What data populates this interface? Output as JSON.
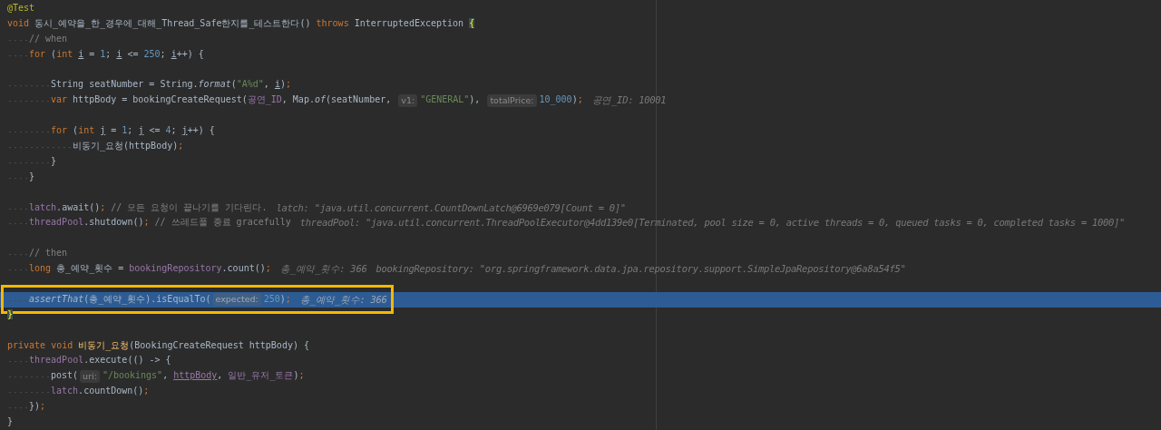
{
  "editor": {
    "lines": [
      {
        "kind": "code",
        "segments": [
          {
            "kind": "code",
            "tokens": [
              {
                "kind": "annot",
                "text": "@Test"
              }
            ]
          }
        ]
      },
      {
        "kind": "code",
        "segments": [
          {
            "kind": "code",
            "tokens": [
              {
                "kind": "kw",
                "text": "void "
              },
              {
                "kind": "plain",
                "text": "동시_예약을_한_경우에_대해_Thread_Safe한지를_테스트한다() "
              },
              {
                "kind": "kw",
                "text": "throws "
              },
              {
                "kind": "plain",
                "text": "InterruptedException "
              },
              {
                "kind": "brace",
                "text": "{"
              }
            ]
          }
        ],
        "children": [
          {
            "kind": "code",
            "segments": [
              {
                "kind": "code",
                "tokens": [
                  {
                    "kind": "cmt",
                    "text": "// when"
                  }
                ]
              }
            ]
          },
          {
            "kind": "code",
            "segments": [
              {
                "kind": "code",
                "tokens": [
                  {
                    "kind": "kw",
                    "text": "for "
                  },
                  {
                    "kind": "plain",
                    "text": "("
                  },
                  {
                    "kind": "kw",
                    "text": "int "
                  },
                  {
                    "kind": "var",
                    "text": "i"
                  },
                  {
                    "kind": "plain",
                    "text": " = "
                  },
                  {
                    "kind": "num",
                    "text": "1"
                  },
                  {
                    "kind": "plain",
                    "text": "; "
                  },
                  {
                    "kind": "var",
                    "text": "i"
                  },
                  {
                    "kind": "plain",
                    "text": " <= "
                  },
                  {
                    "kind": "num",
                    "text": "250"
                  },
                  {
                    "kind": "plain",
                    "text": "; "
                  },
                  {
                    "kind": "var",
                    "text": "i"
                  },
                  {
                    "kind": "plain",
                    "text": "++) {"
                  }
                ]
              }
            ],
            "children": [
              {
                "kind": "blank"
              },
              {
                "kind": "code",
                "segments": [
                  {
                    "kind": "code",
                    "tokens": [
                      {
                        "kind": "plain",
                        "text": "String seatNumber = String."
                      },
                      {
                        "kind": "static",
                        "text": "format"
                      },
                      {
                        "kind": "plain",
                        "text": "("
                      },
                      {
                        "kind": "str",
                        "text": "\"A%d\""
                      },
                      {
                        "kind": "plain",
                        "text": ", "
                      },
                      {
                        "kind": "var",
                        "text": "i"
                      },
                      {
                        "kind": "plain",
                        "text": ")"
                      },
                      {
                        "kind": "kw",
                        "text": ";"
                      }
                    ]
                  }
                ]
              },
              {
                "kind": "code",
                "segments": [
                  {
                    "kind": "code",
                    "tokens": [
                      {
                        "kind": "kw",
                        "text": "var "
                      },
                      {
                        "kind": "plain",
                        "text": "httpBody = bookingCreateRequest("
                      },
                      {
                        "kind": "field",
                        "text": "공연_ID"
                      },
                      {
                        "kind": "plain",
                        "text": ", Map."
                      },
                      {
                        "kind": "static",
                        "text": "of"
                      },
                      {
                        "kind": "plain",
                        "text": "(seatNumber, "
                      }
                    ]
                  },
                  {
                    "kind": "hint",
                    "text": "v1:"
                  },
                  {
                    "kind": "code",
                    "tokens": [
                      {
                        "kind": "str",
                        "text": "\"GENERAL\""
                      },
                      {
                        "kind": "plain",
                        "text": "), "
                      }
                    ]
                  },
                  {
                    "kind": "hint",
                    "text": "totalPrice:"
                  },
                  {
                    "kind": "code",
                    "tokens": [
                      {
                        "kind": "num",
                        "text": "10_000"
                      },
                      {
                        "kind": "plain",
                        "text": ")"
                      },
                      {
                        "kind": "kw",
                        "text": ";"
                      }
                    ]
                  },
                  {
                    "kind": "debug",
                    "text": "공연_ID: 10001"
                  }
                ]
              },
              {
                "kind": "blank"
              },
              {
                "kind": "code",
                "segments": [
                  {
                    "kind": "code",
                    "tokens": [
                      {
                        "kind": "kw",
                        "text": "for "
                      },
                      {
                        "kind": "plain",
                        "text": "("
                      },
                      {
                        "kind": "kw",
                        "text": "int "
                      },
                      {
                        "kind": "var",
                        "text": "j"
                      },
                      {
                        "kind": "plain",
                        "text": " = "
                      },
                      {
                        "kind": "num",
                        "text": "1"
                      },
                      {
                        "kind": "plain",
                        "text": "; "
                      },
                      {
                        "kind": "var",
                        "text": "j"
                      },
                      {
                        "kind": "plain",
                        "text": " <= "
                      },
                      {
                        "kind": "num",
                        "text": "4"
                      },
                      {
                        "kind": "plain",
                        "text": "; "
                      },
                      {
                        "kind": "var",
                        "text": "j"
                      },
                      {
                        "kind": "plain",
                        "text": "++) {"
                      }
                    ]
                  }
                ],
                "children": [
                  {
                    "kind": "code",
                    "segments": [
                      {
                        "kind": "code",
                        "tokens": [
                          {
                            "kind": "plain",
                            "text": "비동기_요청(httpBody)"
                          },
                          {
                            "kind": "kw",
                            "text": ";"
                          }
                        ]
                      }
                    ]
                  }
                ]
              },
              {
                "kind": "code",
                "segments": [
                  {
                    "kind": "code",
                    "tokens": [
                      {
                        "kind": "plain",
                        "text": "}"
                      }
                    ]
                  }
                ]
              }
            ]
          },
          {
            "kind": "code",
            "segments": [
              {
                "kind": "code",
                "tokens": [
                  {
                    "kind": "plain",
                    "text": "}"
                  }
                ]
              }
            ]
          },
          {
            "kind": "blank"
          },
          {
            "kind": "code",
            "segments": [
              {
                "kind": "code",
                "tokens": [
                  {
                    "kind": "field",
                    "text": "latch"
                  },
                  {
                    "kind": "plain",
                    "text": ".await()"
                  },
                  {
                    "kind": "kw",
                    "text": ";"
                  },
                  {
                    "kind": "cmt",
                    "text": " // 모든 요청이 끝나기를 기다린다."
                  }
                ]
              },
              {
                "kind": "debug",
                "text": "latch: \"java.util.concurrent.CountDownLatch@6969e079[Count = 0]\""
              }
            ]
          },
          {
            "kind": "code",
            "segments": [
              {
                "kind": "code",
                "tokens": [
                  {
                    "kind": "field",
                    "text": "threadPool"
                  },
                  {
                    "kind": "plain",
                    "text": ".shutdown()"
                  },
                  {
                    "kind": "kw",
                    "text": ";"
                  },
                  {
                    "kind": "cmt",
                    "text": " // 쓰레드풀 종료 gracefully"
                  }
                ]
              },
              {
                "kind": "debug",
                "text": "threadPool: \"java.util.concurrent.ThreadPoolExecutor@4dd139e0[Terminated, pool size = 0, active threads = 0, queued tasks = 0, completed tasks = 1000]\""
              }
            ]
          },
          {
            "kind": "blank"
          },
          {
            "kind": "code",
            "segments": [
              {
                "kind": "code",
                "tokens": [
                  {
                    "kind": "cmt",
                    "text": "// then"
                  }
                ]
              }
            ]
          },
          {
            "kind": "code",
            "segments": [
              {
                "kind": "code",
                "tokens": [
                  {
                    "kind": "kw",
                    "text": "long "
                  },
                  {
                    "kind": "plain",
                    "text": "총_예약_횟수 = "
                  },
                  {
                    "kind": "field",
                    "text": "bookingRepository"
                  },
                  {
                    "kind": "plain",
                    "text": ".count()"
                  },
                  {
                    "kind": "kw",
                    "text": ";"
                  }
                ]
              },
              {
                "kind": "debug",
                "text": "총_예약_횟수: 366"
              },
              {
                "kind": "debug",
                "text": "bookingRepository: \"org.springframework.data.jpa.repository.support.SimpleJpaRepository@6a8a54f5\""
              }
            ]
          },
          {
            "kind": "blank"
          },
          {
            "kind": "code",
            "selected": true,
            "boxed": true,
            "segments": [
              {
                "kind": "code",
                "tokens": [
                  {
                    "kind": "static",
                    "text": "assertThat"
                  },
                  {
                    "kind": "plain",
                    "text": "(총_예약_횟수).isEqualTo("
                  }
                ]
              },
              {
                "kind": "hint",
                "text": "expected:"
              },
              {
                "kind": "code",
                "tokens": [
                  {
                    "kind": "num",
                    "text": "250"
                  },
                  {
                    "kind": "plain",
                    "text": ")"
                  },
                  {
                    "kind": "kw",
                    "text": ";"
                  }
                ]
              },
              {
                "kind": "debug",
                "text": "총_예약_횟수: 366"
              }
            ]
          }
        ]
      },
      {
        "kind": "code",
        "segments": [
          {
            "kind": "code",
            "tokens": [
              {
                "kind": "brace",
                "text": "}"
              }
            ]
          }
        ]
      },
      {
        "kind": "blank"
      },
      {
        "kind": "code",
        "segments": [
          {
            "kind": "code",
            "tokens": [
              {
                "kind": "kw",
                "text": "private void "
              },
              {
                "kind": "decl",
                "text": "비동기_요청"
              },
              {
                "kind": "plain",
                "text": "(BookingCreateRequest httpBody) {"
              }
            ]
          }
        ],
        "children": [
          {
            "kind": "code",
            "segments": [
              {
                "kind": "code",
                "tokens": [
                  {
                    "kind": "field",
                    "text": "threadPool"
                  },
                  {
                    "kind": "plain",
                    "text": ".execute(() -> {"
                  }
                ]
              }
            ],
            "children": [
              {
                "kind": "code",
                "segments": [
                  {
                    "kind": "code",
                    "tokens": [
                      {
                        "kind": "plain",
                        "text": "post("
                      }
                    ]
                  },
                  {
                    "kind": "hint",
                    "text": "uri:"
                  },
                  {
                    "kind": "code",
                    "tokens": [
                      {
                        "kind": "str",
                        "text": "\"/bookings\""
                      },
                      {
                        "kind": "plain",
                        "text": ", "
                      },
                      {
                        "kind": "fieldu",
                        "text": "httpBody"
                      },
                      {
                        "kind": "plain",
                        "text": ", "
                      },
                      {
                        "kind": "field",
                        "text": "일반_유저_토큰"
                      },
                      {
                        "kind": "plain",
                        "text": ")"
                      },
                      {
                        "kind": "kw",
                        "text": ";"
                      }
                    ]
                  }
                ]
              },
              {
                "kind": "code",
                "segments": [
                  {
                    "kind": "code",
                    "tokens": [
                      {
                        "kind": "field",
                        "text": "latch"
                      },
                      {
                        "kind": "plain",
                        "text": ".countDown()"
                      },
                      {
                        "kind": "kw",
                        "text": ";"
                      }
                    ]
                  }
                ]
              }
            ]
          },
          {
            "kind": "code",
            "segments": [
              {
                "kind": "code",
                "tokens": [
                  {
                    "kind": "plain",
                    "text": "})"
                  },
                  {
                    "kind": "kw",
                    "text": ";"
                  }
                ]
              }
            ]
          }
        ]
      },
      {
        "kind": "code",
        "segments": [
          {
            "kind": "code",
            "tokens": [
              {
                "kind": "plain",
                "text": "}"
              }
            ]
          }
        ]
      }
    ]
  }
}
